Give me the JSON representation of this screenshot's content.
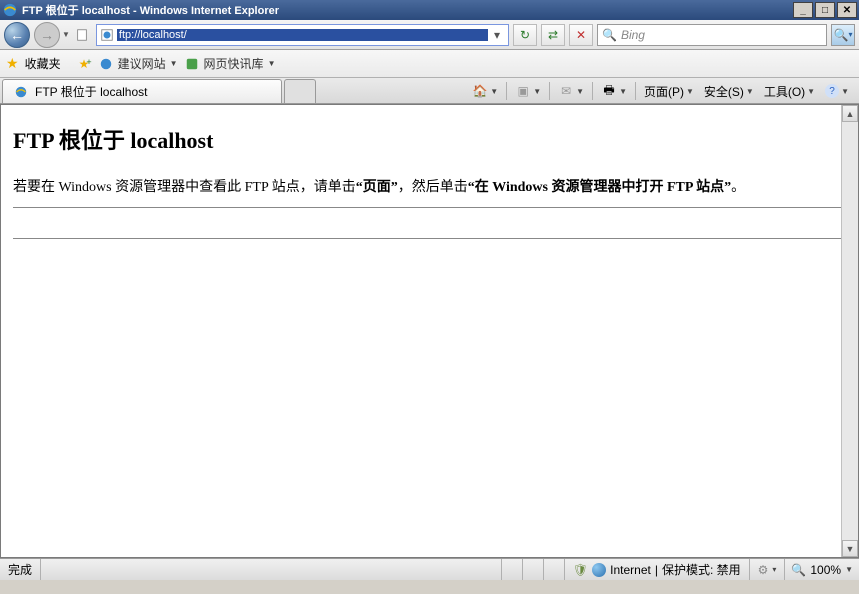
{
  "titlebar": {
    "title": "FTP 根位于 localhost - Windows Internet Explorer"
  },
  "address": {
    "url": "ftp://localhost/"
  },
  "toolbar": {
    "refresh_icon": "↻",
    "compat_icon": "📄",
    "stop_icon": "✕"
  },
  "search": {
    "placeholder": "Bing"
  },
  "favbar": {
    "favorites_label": "收藏夹",
    "suggested_sites": "建议网站",
    "web_slice": "网页快讯库"
  },
  "tab": {
    "title": "FTP 根位于 localhost"
  },
  "cmdbar": {
    "page": "页面(P)",
    "safety": "安全(S)",
    "tools": "工具(O)"
  },
  "page": {
    "heading": "FTP 根位于 localhost",
    "para_prefix": "若要在 Windows 资源管理器中查看此 FTP 站点，请单击",
    "bold1": "“页面”",
    "para_mid": "，然后单击",
    "bold2": "“在 Windows 资源管理器中打开 FTP 站点”",
    "para_suffix": "。"
  },
  "status": {
    "done": "完成",
    "zone": "Internet",
    "protected_mode": "保护模式: 禁用",
    "zoom": "100%"
  }
}
